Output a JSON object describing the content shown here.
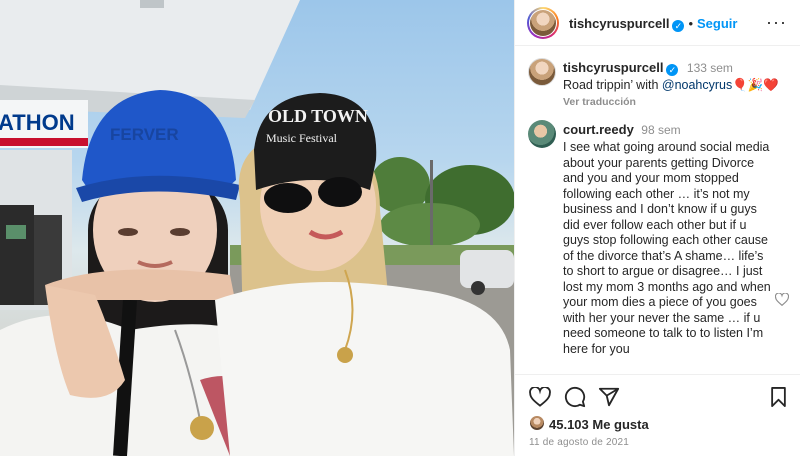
{
  "photo": {
    "station_sign": "ATHON",
    "hat_left_text": "FERVER",
    "hat_right_line1": "OLD TOWN",
    "hat_right_line2": "Music Festival"
  },
  "header": {
    "username": "tishcyruspurcell",
    "follow_label": "Seguir",
    "more_label": "···"
  },
  "caption": {
    "username": "tishcyruspurcell",
    "time": "133 sem",
    "text_prefix": "Road trippin’ with ",
    "mention": "@noahcyrus",
    "emoji": "🎈🎉❤️",
    "translate_label": "Ver traducción"
  },
  "comment": {
    "username": "court.reedy",
    "time": "98 sem",
    "text": "I see what going around social media about your parents getting Divorce and you and your mom stopped following each other … it’s not my business and I don’t know if u guys did ever follow each other but if u guys stop following each other cause of the divorce that’s A shame… life’s to short to argue or disagree… I just lost my mom 3 months ago and when your mom dies a piece of you goes with her your never the same … if u need someone to talk to to listen I’m here for you"
  },
  "footer": {
    "likes": "45.103 Me gusta",
    "date": "11 de agosto de 2021"
  },
  "colors": {
    "accent": "#0095f6",
    "text": "#262626",
    "muted": "#8e8e8e",
    "border": "#efefef"
  },
  "icons": [
    "heart-icon",
    "comment-icon",
    "share-icon",
    "bookmark-icon",
    "verified-icon",
    "more-icon",
    "comment-like-icon"
  ]
}
